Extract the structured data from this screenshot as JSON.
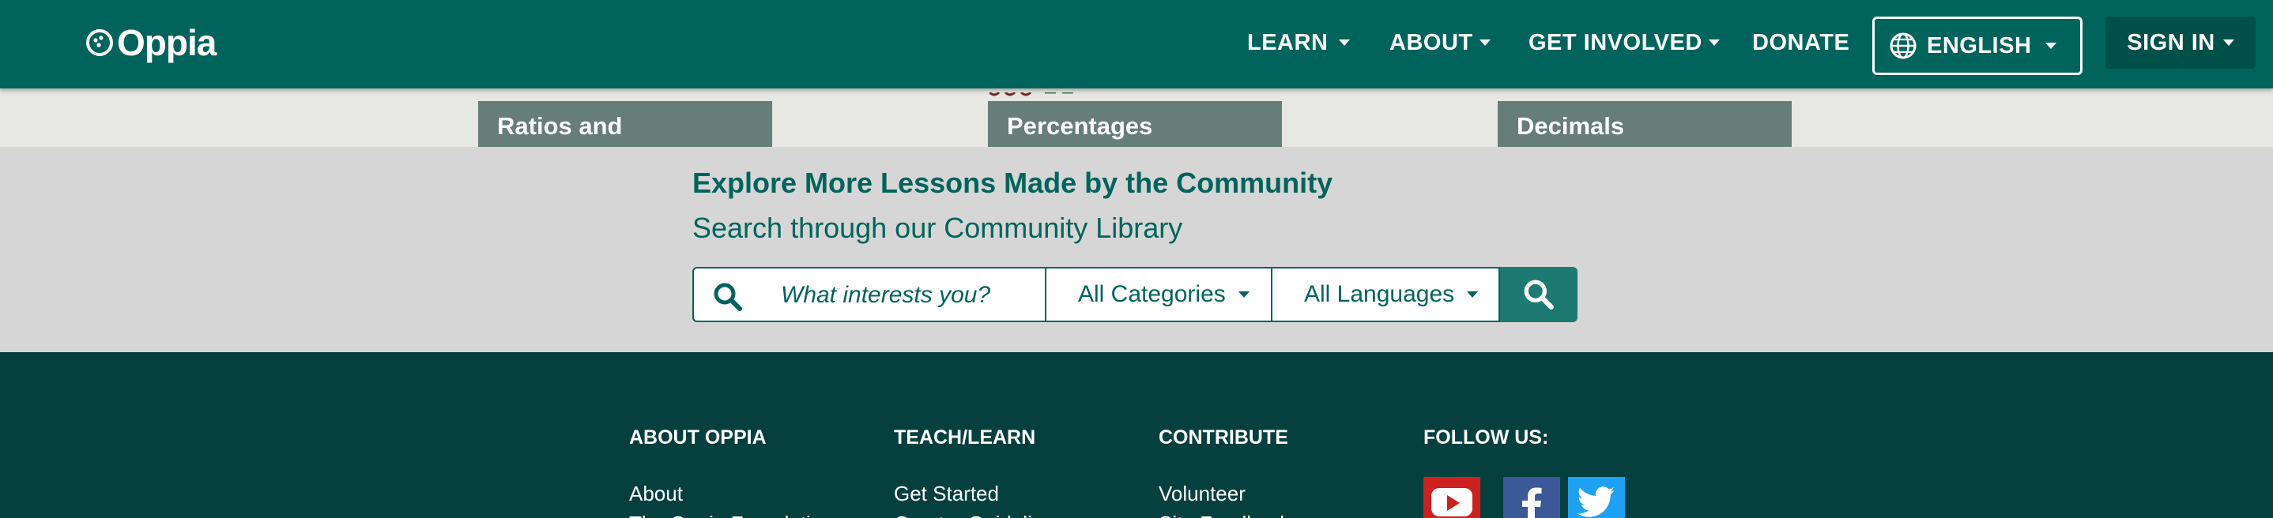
{
  "nav": {
    "logo_text": "Oppia",
    "items": [
      {
        "label": "LEARN",
        "has_caret": true
      },
      {
        "label": "ABOUT",
        "has_caret": true
      },
      {
        "label": "GET INVOLVED",
        "has_caret": true
      },
      {
        "label": "DONATE",
        "has_caret": false
      }
    ],
    "language_button": "ENGLISH",
    "sign_in": "SIGN IN"
  },
  "lesson_cards": [
    {
      "title": "Ratios and"
    },
    {
      "title": "Percentages"
    },
    {
      "title": "Decimals"
    }
  ],
  "community": {
    "heading": "Explore More Lessons Made by the Community",
    "subheading": "Search through our Community Library",
    "search_placeholder": "What interests you?",
    "category_select": "All Categories",
    "language_select": "All Languages"
  },
  "footer": {
    "columns": [
      {
        "heading": "ABOUT OPPIA",
        "links": [
          "About",
          "The Oppia Foundation"
        ]
      },
      {
        "heading": "TEACH/LEARN",
        "links": [
          "Get Started",
          "Creator Guidelines"
        ]
      },
      {
        "heading": "CONTRIBUTE",
        "links": [
          "Volunteer",
          "Site Feedback"
        ]
      },
      {
        "heading": "FOLLOW US:",
        "links": []
      }
    ],
    "social": [
      {
        "icon": "youtube-icon",
        "color": "#cd201f"
      },
      {
        "icon": "facebook-icon",
        "color": "#3b5998"
      },
      {
        "icon": "twitter-icon",
        "color": "#1da1f2"
      }
    ]
  },
  "colors": {
    "brand": "#00645c",
    "footer_bg": "#05403e",
    "section_bg": "#d6d6d6",
    "card_bg": "#667d78"
  }
}
